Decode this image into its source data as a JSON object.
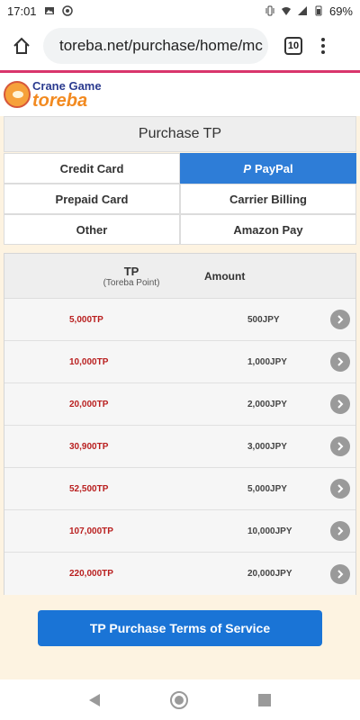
{
  "status_bar": {
    "time": "17:01",
    "battery": "69%"
  },
  "browser": {
    "url": "toreba.net/purchase/home/mc",
    "tab_count": "10"
  },
  "site": {
    "logo_line1": "Crane Game",
    "logo_line2": "toreba"
  },
  "purchase": {
    "title": "Purchase TP",
    "payment_methods": [
      {
        "label": "Credit Card",
        "active": false
      },
      {
        "label": "PayPal",
        "active": true
      },
      {
        "label": "Prepaid Card",
        "active": false
      },
      {
        "label": "Carrier Billing",
        "active": false
      },
      {
        "label": "Other",
        "active": false
      },
      {
        "label": "Amazon Pay",
        "active": false
      }
    ],
    "table": {
      "col_tp_title": "TP",
      "col_tp_sub": "(Toreba Point)",
      "col_amount": "Amount",
      "rows": [
        {
          "tp": "5,000TP",
          "amount": "500JPY"
        },
        {
          "tp": "10,000TP",
          "amount": "1,000JPY"
        },
        {
          "tp": "20,000TP",
          "amount": "2,000JPY"
        },
        {
          "tp": "30,900TP",
          "amount": "3,000JPY"
        },
        {
          "tp": "52,500TP",
          "amount": "5,000JPY"
        },
        {
          "tp": "107,000TP",
          "amount": "10,000JPY"
        },
        {
          "tp": "220,000TP",
          "amount": "20,000JPY"
        }
      ]
    },
    "tos_button": "TP Purchase Terms of Service"
  },
  "colors": {
    "accent": "#d9356c",
    "active_tab": "#2e7dd7",
    "tp_red": "#b91f1f",
    "tos_blue": "#1a74d6"
  }
}
